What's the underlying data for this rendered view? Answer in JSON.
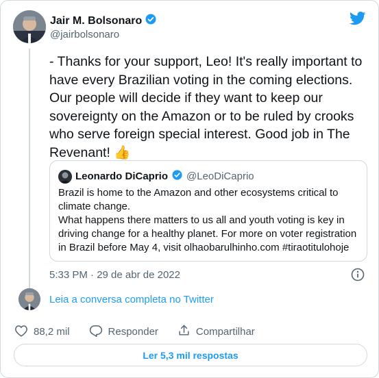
{
  "author": {
    "name": "Jair M. Bolsonaro",
    "handle": "@jairbolsonaro",
    "verified": true
  },
  "tweet": {
    "text": "- Thanks for your support, Leo! It's really important to have every Brazilian voting in the coming elections. Our people will decide if they want to keep our sovereignty on the Amazon or to be ruled by crooks who serve foreign special interest. Good job in The Revenant! 👍",
    "timestamp": "5:33 PM · 29 de abr de 2022"
  },
  "quoted": {
    "name": "Leonardo DiCaprio",
    "handle": "@LeoDiCaprio",
    "verified": true,
    "text": "Brazil is home to the Amazon and other ecosystems critical to climate change.\nWhat happens there matters to us all and youth voting is key in driving change for a healthy planet. For more on voter registration in Brazil before May 4, visit olhaobarulhinho.com #tiraotitulohoje"
  },
  "thread": {
    "read_more_label": "Leia a conversa completa no Twitter"
  },
  "actions": {
    "like_count": "88,2 mil",
    "reply_label": "Responder",
    "share_label": "Compartilhar"
  },
  "replies_button": {
    "label": "Ler 5,3 mil respostas"
  },
  "colors": {
    "accent": "#1d9bf0",
    "muted": "#536471",
    "border": "#cfd9de"
  },
  "icons": [
    "twitter-bird-icon",
    "verified-badge-icon",
    "info-icon",
    "heart-icon",
    "reply-icon",
    "share-icon"
  ]
}
